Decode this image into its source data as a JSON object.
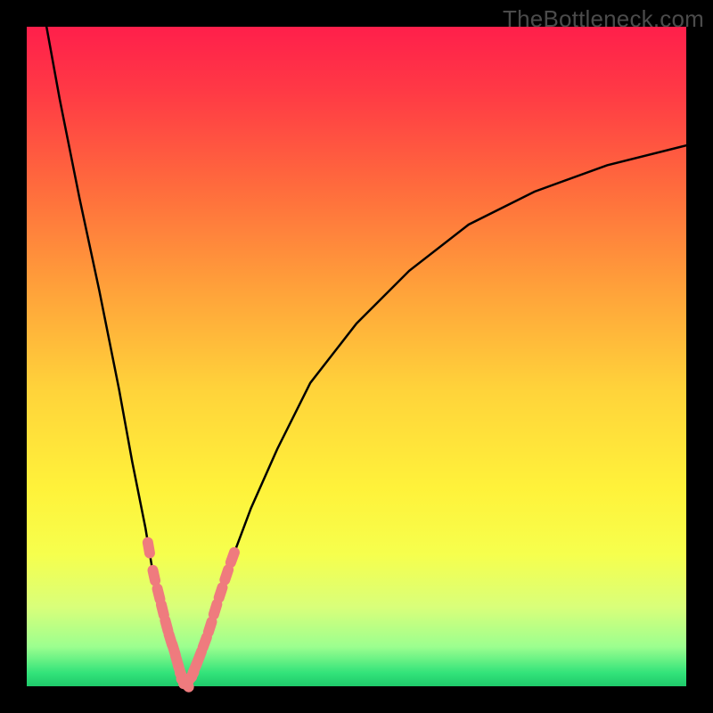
{
  "credit_text": "TheBottleneck.com",
  "colors": {
    "frame": "#000000",
    "gradient_top": "#ff1f4b",
    "gradient_bottom": "#1fc96a",
    "curve": "#000000",
    "marker": "#ef7b7e"
  },
  "chart_data": {
    "type": "line",
    "title": "",
    "xlabel": "",
    "ylabel": "",
    "xlim": [
      0,
      100
    ],
    "ylim": [
      0,
      100
    ],
    "series": [
      {
        "name": "left-branch",
        "x": [
          3,
          5,
          8,
          11,
          14,
          16,
          18,
          19,
          20.5,
          21.5,
          22.5,
          23,
          23.5,
          24
        ],
        "values": [
          100,
          89,
          74,
          60,
          45,
          34,
          24,
          18,
          12,
          8,
          5,
          3,
          1.5,
          0.5
        ]
      },
      {
        "name": "right-branch",
        "x": [
          24,
          25,
          26,
          27.5,
          29,
          31,
          34,
          38,
          43,
          50,
          58,
          67,
          77,
          88,
          100
        ],
        "values": [
          0.5,
          1.5,
          4,
          8,
          13,
          19,
          27,
          36,
          46,
          55,
          63,
          70,
          75,
          79,
          82
        ]
      }
    ],
    "highlighted_points": {
      "left_branch_x": [
        18.5,
        19.3,
        20.0,
        20.6,
        21.2,
        21.8,
        22.3,
        22.8,
        23.2,
        23.6,
        24.0
      ],
      "right_branch_x": [
        24.4,
        24.9,
        25.5,
        26.2,
        27.0,
        27.8,
        28.6,
        29.4,
        30.3,
        31.2
      ]
    }
  }
}
